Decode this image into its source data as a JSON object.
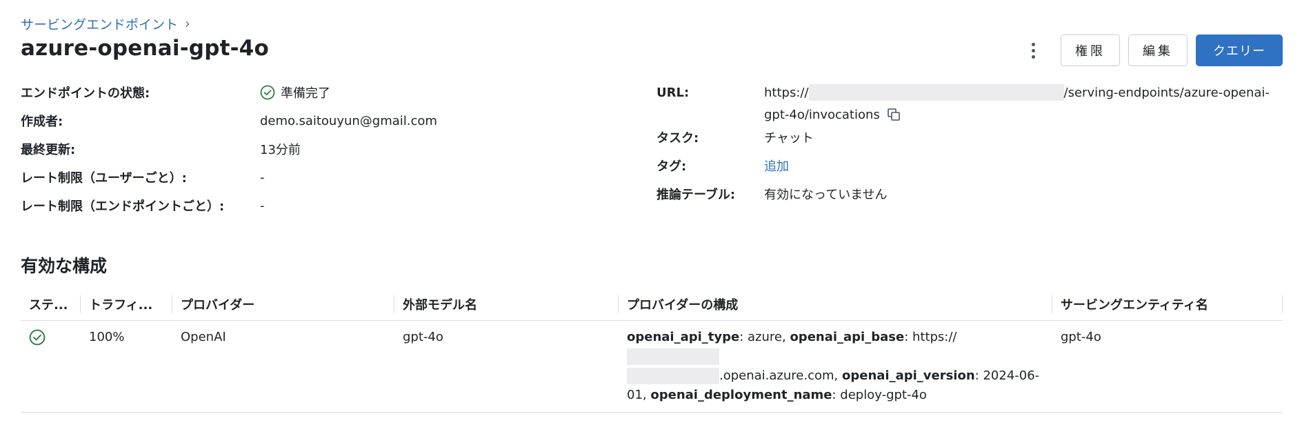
{
  "breadcrumb": {
    "label": "サービングエンドポイント",
    "chevron": "›"
  },
  "title": "azure-openai-gpt-4o",
  "actions": {
    "permissions": "権限",
    "edit": "編集",
    "query": "クエリー"
  },
  "details_left": [
    {
      "label": "エンドポイントの状態:",
      "value": "準備完了"
    },
    {
      "label": "作成者:",
      "value": "demo.saitouyun@gmail.com"
    },
    {
      "label": "最終更新:",
      "value": "13分前"
    },
    {
      "label": "レート制限（ユーザーごと）:",
      "value": "-"
    },
    {
      "label": "レート制限（エンドポイントごと）:",
      "value": "-"
    }
  ],
  "details_right": {
    "url_label": "URL:",
    "url_prefix": "https://",
    "url_suffix": "/serving-endpoints/azure-openai-",
    "url_line2": "gpt-4o/invocations",
    "task_label": "タスク:",
    "task_value": "チャット",
    "tags_label": "タグ:",
    "tags_value": "追加",
    "inference_label": "推論テーブル:",
    "inference_value": "有効になっていません"
  },
  "section_title": "有効な構成",
  "table": {
    "headers": [
      "ステ...",
      "トラフィ...",
      "プロバイダー",
      "外部モデル名",
      "プロバイダーの構成",
      "サービングエンティティ名"
    ],
    "row": {
      "traffic": "100%",
      "provider": "OpenAI",
      "model": "gpt-4o",
      "config": {
        "k1": "openai_api_type",
        "v1": ": azure, ",
        "k2": "openai_api_base",
        "v2": ": https://",
        "v2b": ".openai.azure.com, ",
        "k3": "openai_api_version",
        "v3": ": 2024-06-",
        "v3b": "01, ",
        "k4": "openai_deployment_name",
        "v4": ": deploy-gpt-4o"
      },
      "entity": "gpt-4o"
    }
  },
  "colors": {
    "accent": "#2f72c4",
    "link": "#2f6fb7",
    "success": "#2e7d46"
  },
  "icons": {
    "status": "check-circle-icon",
    "copy": "copy-icon",
    "more": "kebab-menu-icon"
  }
}
